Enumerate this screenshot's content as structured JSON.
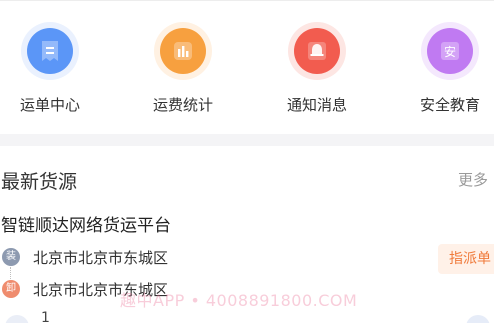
{
  "menu": {
    "items": [
      {
        "label": "运单中心",
        "icon": "waybill-icon",
        "color": "#4f8df7"
      },
      {
        "label": "运费统计",
        "icon": "bar-chart-icon",
        "color": "#f79a33"
      },
      {
        "label": "通知消息",
        "icon": "bell-icon",
        "color": "#f0574a"
      },
      {
        "label": "安全教育",
        "icon": "safety-icon",
        "color": "#b66ef0"
      }
    ]
  },
  "latest": {
    "title": "最新货源",
    "more_label": "更多 >",
    "card": {
      "company": "智链顺达网络货运平台",
      "load_badge": "装",
      "unload_badge": "卸",
      "load_address": "北京市北京市东城区",
      "unload_address": "北京市北京市东城区",
      "action_label": "指派单"
    },
    "next_card_number": "1"
  },
  "watermark_text": "趣中APP • 4008891800.COM"
}
